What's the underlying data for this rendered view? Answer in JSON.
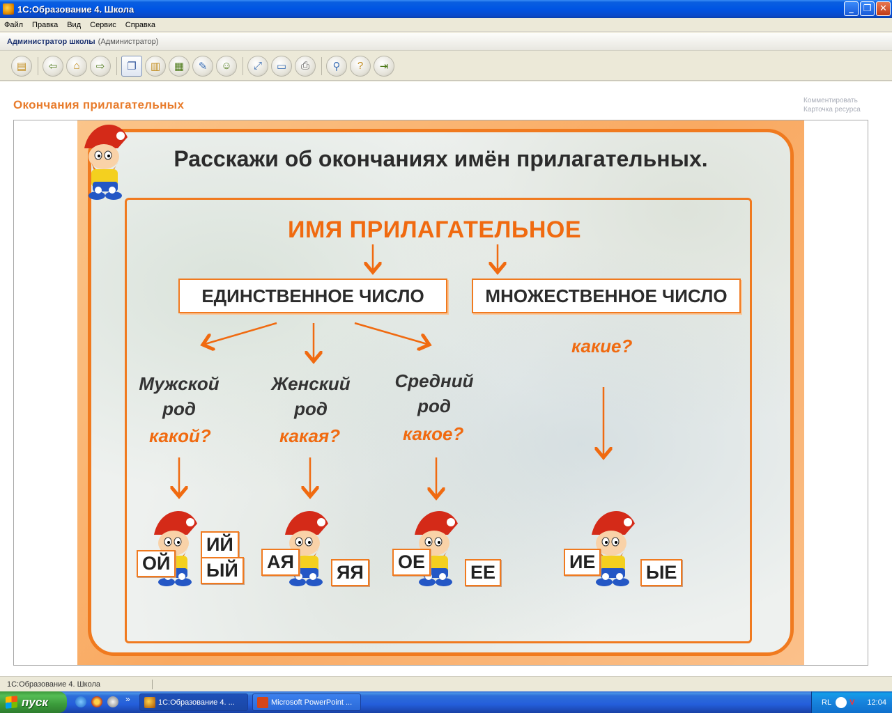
{
  "window": {
    "title": "1С:Образование 4. Школа",
    "buttons": {
      "minimize": "_",
      "maximize": "❐",
      "close": "✕"
    }
  },
  "menu": [
    "Файл",
    "Правка",
    "Вид",
    "Сервис",
    "Справка"
  ],
  "userbar": {
    "user": "Администратор школы",
    "role": "(Администратор)"
  },
  "toolbar": {
    "icons": [
      "catalog-icon",
      "back-arrow-icon",
      "home-icon",
      "forward-arrow-icon",
      "page-icon",
      "book-icon",
      "bookshelf-icon",
      "edit-icon",
      "users-icon",
      "resize-icon",
      "display-icon",
      "print-icon",
      "search-icon",
      "help-icon",
      "exit-icon"
    ]
  },
  "page": {
    "title": "Окончания прилагательных",
    "links": [
      "Комментировать",
      "Карточка ресурса"
    ]
  },
  "slide": {
    "heading": "Расскажи об окончаниях имён прилагательных.",
    "main_term": "ИМЯ  ПРИЛАГАТЕЛЬНОЕ",
    "singular": "ЕДИНСТВЕННОЕ ЧИСЛО",
    "plural": "МНОЖЕСТВЕННОЕ ЧИСЛО",
    "genders": [
      {
        "line1": "Мужской",
        "line2": "род",
        "question": "какой?",
        "endings": [
          "ИЙ",
          "ОЙ",
          "ЫЙ"
        ]
      },
      {
        "line1": "Женский",
        "line2": "род",
        "question": "какая?",
        "endings": [
          "АЯ",
          "ЯЯ"
        ]
      },
      {
        "line1": "Средний",
        "line2": "род",
        "question": "какое?",
        "endings": [
          "ОЕ",
          "ЕЕ"
        ]
      }
    ],
    "plural_question": "какие?",
    "plural_endings": [
      "ИЕ",
      "ЫЕ"
    ],
    "colors": {
      "accent": "#f07a1f",
      "text": "#2b2b2b"
    }
  },
  "statusbar": {
    "text": "1С:Образование 4. Школа"
  },
  "taskbar": {
    "start_label": "пуск",
    "quicklaunch_more": "»",
    "tasks": [
      "1С:Образование 4. ...",
      "Microsoft PowerPoint ..."
    ],
    "tray": {
      "lang": "RL",
      "time": "12:04"
    }
  }
}
